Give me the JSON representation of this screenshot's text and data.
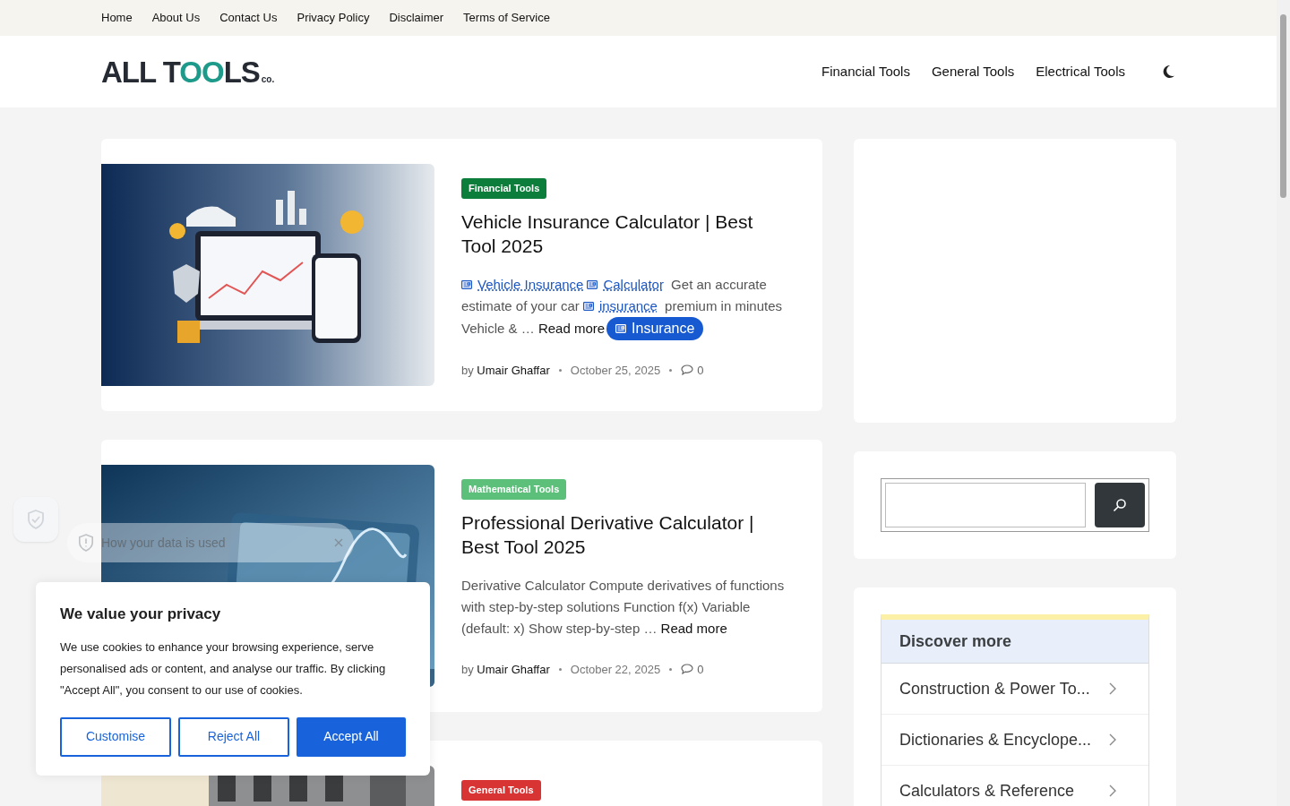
{
  "top_nav": [
    "Home",
    "About Us",
    "Contact Us",
    "Privacy Policy",
    "Disclaimer",
    "Terms of Service"
  ],
  "logo": {
    "start": "ALL T",
    "accent": "OO",
    "end": "LS",
    "suffix": "co."
  },
  "main_nav": [
    "Financial Tools",
    "General Tools",
    "Electrical Tools"
  ],
  "posts": [
    {
      "category": "Financial Tools",
      "color": "#0c7d3a",
      "title": "Vehicle Insurance Calculator | Best Tool 2025",
      "excerpt": [
        {
          "kind": "link",
          "text": "Vehicle Insurance"
        },
        {
          "kind": "link",
          "text": "Calculator"
        },
        {
          "kind": "text",
          "text": " Get an accurate estimate of your car "
        },
        {
          "kind": "link",
          "text": "insurance"
        },
        {
          "kind": "text",
          "text": " premium in minutes Vehicle & … "
        }
      ],
      "read_more": "Read more",
      "chip": "Insurance",
      "author_prefix": "by",
      "author": "Umair Ghaffar",
      "date": "October 25, 2025",
      "comments": "0",
      "kind": "picture"
    },
    {
      "category": "Mathematical Tools",
      "color": "#5cbf7a",
      "title": "Professional Derivative Calculator | Best Tool 2025",
      "excerpt": [
        {
          "kind": "text",
          "text": "Derivative Calculator Compute derivatives of functions with step-by-step solutions Function f(x) Variable (default: x) Show step-by-step … "
        }
      ],
      "read_more": "Read more",
      "author_prefix": "by",
      "author": "Umair Ghaffar",
      "date": "October 22, 2025",
      "comments": "0",
      "kind": "picture"
    },
    {
      "category": "General Tools",
      "color": "#d93434",
      "kind": "picture"
    }
  ],
  "discover": {
    "title": "Discover more",
    "items": [
      "Construction & Power To...",
      "Dictionaries & Encyclope...",
      "Calculators & Reference"
    ]
  },
  "data_notice": {
    "title": "How your data is used"
  },
  "cookie": {
    "title": "We value your privacy",
    "text": "We use cookies to enhance your browsing experience, serve personalised ads or content, and analyse our traffic. By clicking \"Accept All\", you consent to our use of cookies.",
    "buttons": [
      {
        "label": "Customise",
        "kind": "outline"
      },
      {
        "label": "Reject All",
        "kind": "outline"
      },
      {
        "label": "Accept All",
        "kind": "primary"
      }
    ]
  }
}
